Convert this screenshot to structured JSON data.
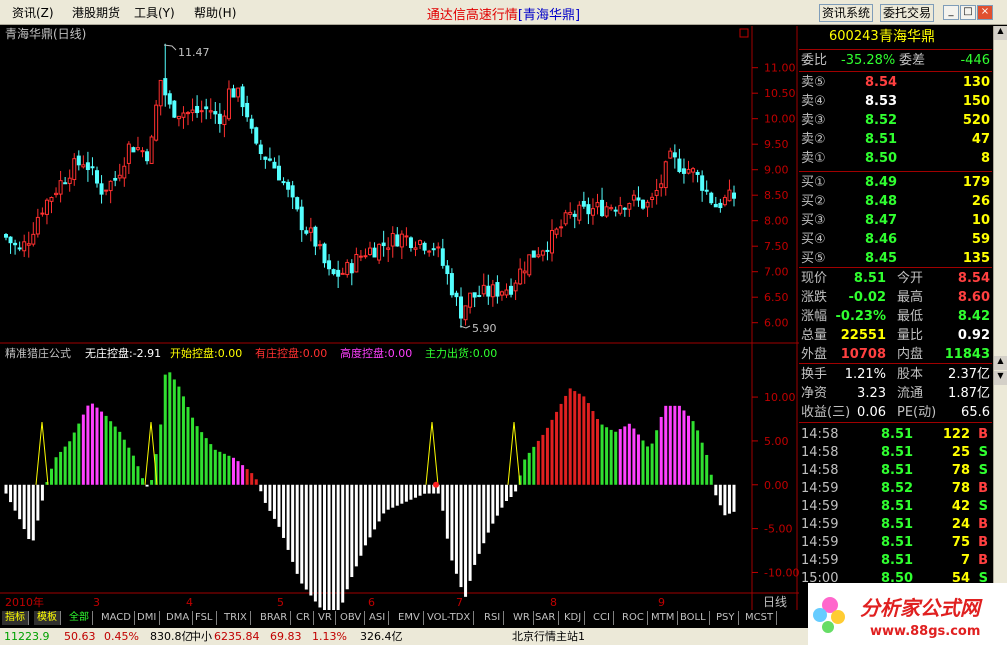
{
  "menu": {
    "items": [
      "资讯(Z)",
      "港股期货",
      "工具(Y)",
      "帮助(H)"
    ]
  },
  "app_title": {
    "main": "通达信高速行情",
    "sub": "[青海华鼎]"
  },
  "toolbar": {
    "btn1": "资讯系统",
    "btn2": "委托交易",
    "minimize": "_",
    "maximize": "□",
    "close": "×"
  },
  "chart_data": [
    {
      "type": "candlestick",
      "title": "青海华鼎(日线)",
      "ylim": [
        5.7,
        11.7
      ],
      "y_ticks": [
        "11.00",
        "10.50",
        "10.00",
        "9.50",
        "9.00",
        "8.50",
        "8.00",
        "7.50",
        "7.00",
        "6.50",
        "6.00"
      ],
      "y_tick_values": [
        11.0,
        10.5,
        10.0,
        9.5,
        9.0,
        8.5,
        8.0,
        7.5,
        7.0,
        6.5,
        6.0
      ],
      "annotations": {
        "high": "11.47",
        "low": "5.90"
      },
      "x_labels": [
        "2010年",
        "3",
        "4",
        "5",
        "6",
        "7",
        "8",
        "9"
      ],
      "period": "日线"
    },
    {
      "type": "bar",
      "title": "精准猎庄公式",
      "ylim": [
        -12,
        14
      ],
      "y_ticks": [
        "10.00",
        "5.00",
        "0.00",
        "-5.00",
        "-10.00"
      ],
      "y_tick_values": [
        10,
        5,
        0,
        -5,
        -10
      ],
      "legend": [
        {
          "label": "无庄控盘:-2.91",
          "color": "#ffffff"
        },
        {
          "label": "开始控盘:0.00",
          "color": "#ffff00"
        },
        {
          "label": "有庄控盘:0.00",
          "color": "#ff3030"
        },
        {
          "label": "高度控盘:0.00",
          "color": "#ff40ff"
        },
        {
          "label": "主力出货:0.00",
          "color": "#30ff30"
        }
      ]
    }
  ],
  "quote": {
    "code": "600243",
    "name": "青海华鼎",
    "weibi_label": "委比",
    "weibi": "-35.28%",
    "weicha_label": "委差",
    "weicha": "-446",
    "sells": [
      {
        "label": "卖⑤",
        "price": "8.54",
        "vol": "130",
        "color": "#ff4040"
      },
      {
        "label": "卖④",
        "price": "8.53",
        "vol": "150",
        "color": "#ffffff"
      },
      {
        "label": "卖③",
        "price": "8.52",
        "vol": "520",
        "color": "#30ff30"
      },
      {
        "label": "卖②",
        "price": "8.51",
        "vol": "47",
        "color": "#30ff30"
      },
      {
        "label": "卖①",
        "price": "8.50",
        "vol": "8",
        "color": "#30ff30"
      }
    ],
    "buys": [
      {
        "label": "买①",
        "price": "8.49",
        "vol": "179",
        "color": "#30ff30"
      },
      {
        "label": "买②",
        "price": "8.48",
        "vol": "26",
        "color": "#30ff30"
      },
      {
        "label": "买③",
        "price": "8.47",
        "vol": "10",
        "color": "#30ff30"
      },
      {
        "label": "买④",
        "price": "8.46",
        "vol": "59",
        "color": "#30ff30"
      },
      {
        "label": "买⑤",
        "price": "8.45",
        "vol": "135",
        "color": "#30ff30"
      }
    ],
    "stats": [
      {
        "l1": "现价",
        "v1": "8.51",
        "c1": "#30ff30",
        "l2": "今开",
        "v2": "8.54",
        "c2": "#ff4040"
      },
      {
        "l1": "涨跌",
        "v1": "-0.02",
        "c1": "#30ff30",
        "l2": "最高",
        "v2": "8.60",
        "c2": "#ff4040"
      },
      {
        "l1": "涨幅",
        "v1": "-0.23%",
        "c1": "#30ff30",
        "l2": "最低",
        "v2": "8.42",
        "c2": "#30ff30"
      },
      {
        "l1": "总量",
        "v1": "22551",
        "c1": "#ffff00",
        "l2": "量比",
        "v2": "0.92",
        "c2": "#ffffff"
      },
      {
        "l1": "外盘",
        "v1": "10708",
        "c1": "#ff4040",
        "l2": "内盘",
        "v2": "11843",
        "c2": "#30ff30"
      }
    ],
    "fund": [
      {
        "l1": "换手",
        "v1": "1.21%",
        "l2": "股本",
        "v2": "2.37亿"
      },
      {
        "l1": "净资",
        "v1": "3.23",
        "l2": "流通",
        "v2": "1.87亿"
      },
      {
        "l1": "收益(三)",
        "v1": "0.06",
        "l2": "PE(动)",
        "v2": "65.6"
      }
    ],
    "ticks": [
      {
        "t": "14:58",
        "p": "8.51",
        "v": "122",
        "bs": "B"
      },
      {
        "t": "14:58",
        "p": "8.51",
        "v": "25",
        "bs": "S"
      },
      {
        "t": "14:58",
        "p": "8.51",
        "v": "78",
        "bs": "S"
      },
      {
        "t": "14:59",
        "p": "8.52",
        "v": "78",
        "bs": "B"
      },
      {
        "t": "14:59",
        "p": "8.51",
        "v": "42",
        "bs": "S"
      },
      {
        "t": "14:59",
        "p": "8.51",
        "v": "24",
        "bs": "B"
      },
      {
        "t": "14:59",
        "p": "8.51",
        "v": "75",
        "bs": "B"
      },
      {
        "t": "14:59",
        "p": "8.51",
        "v": "7",
        "bs": "B"
      },
      {
        "t": "15:00",
        "p": "8.50",
        "v": "54",
        "bs": "S"
      }
    ]
  },
  "tabs": [
    "指标",
    "模板",
    "全部",
    "MACD",
    "DMI",
    "DMA",
    "FSL",
    "TRIX",
    "BRAR",
    "CR",
    "VR",
    "OBV",
    "ASI",
    "EMV",
    "VOL-TDX",
    "RSI",
    "WR",
    "SAR",
    "KDJ",
    "CCI",
    "ROC",
    "MTM",
    "BOLL",
    "PSY",
    "MCST"
  ],
  "status": {
    "s1": "11223.9",
    "s2": "50.63",
    "s3": "0.45%",
    "s4": "830.8亿",
    "s5": "中小",
    "s6": "6235.84",
    "s7": "69.83",
    "s8": "1.13%",
    "s9": "326.4亿",
    "s10": "北京行情主站1"
  },
  "logo": {
    "text": "分析家公式网",
    "url": "www.88gs.com"
  }
}
